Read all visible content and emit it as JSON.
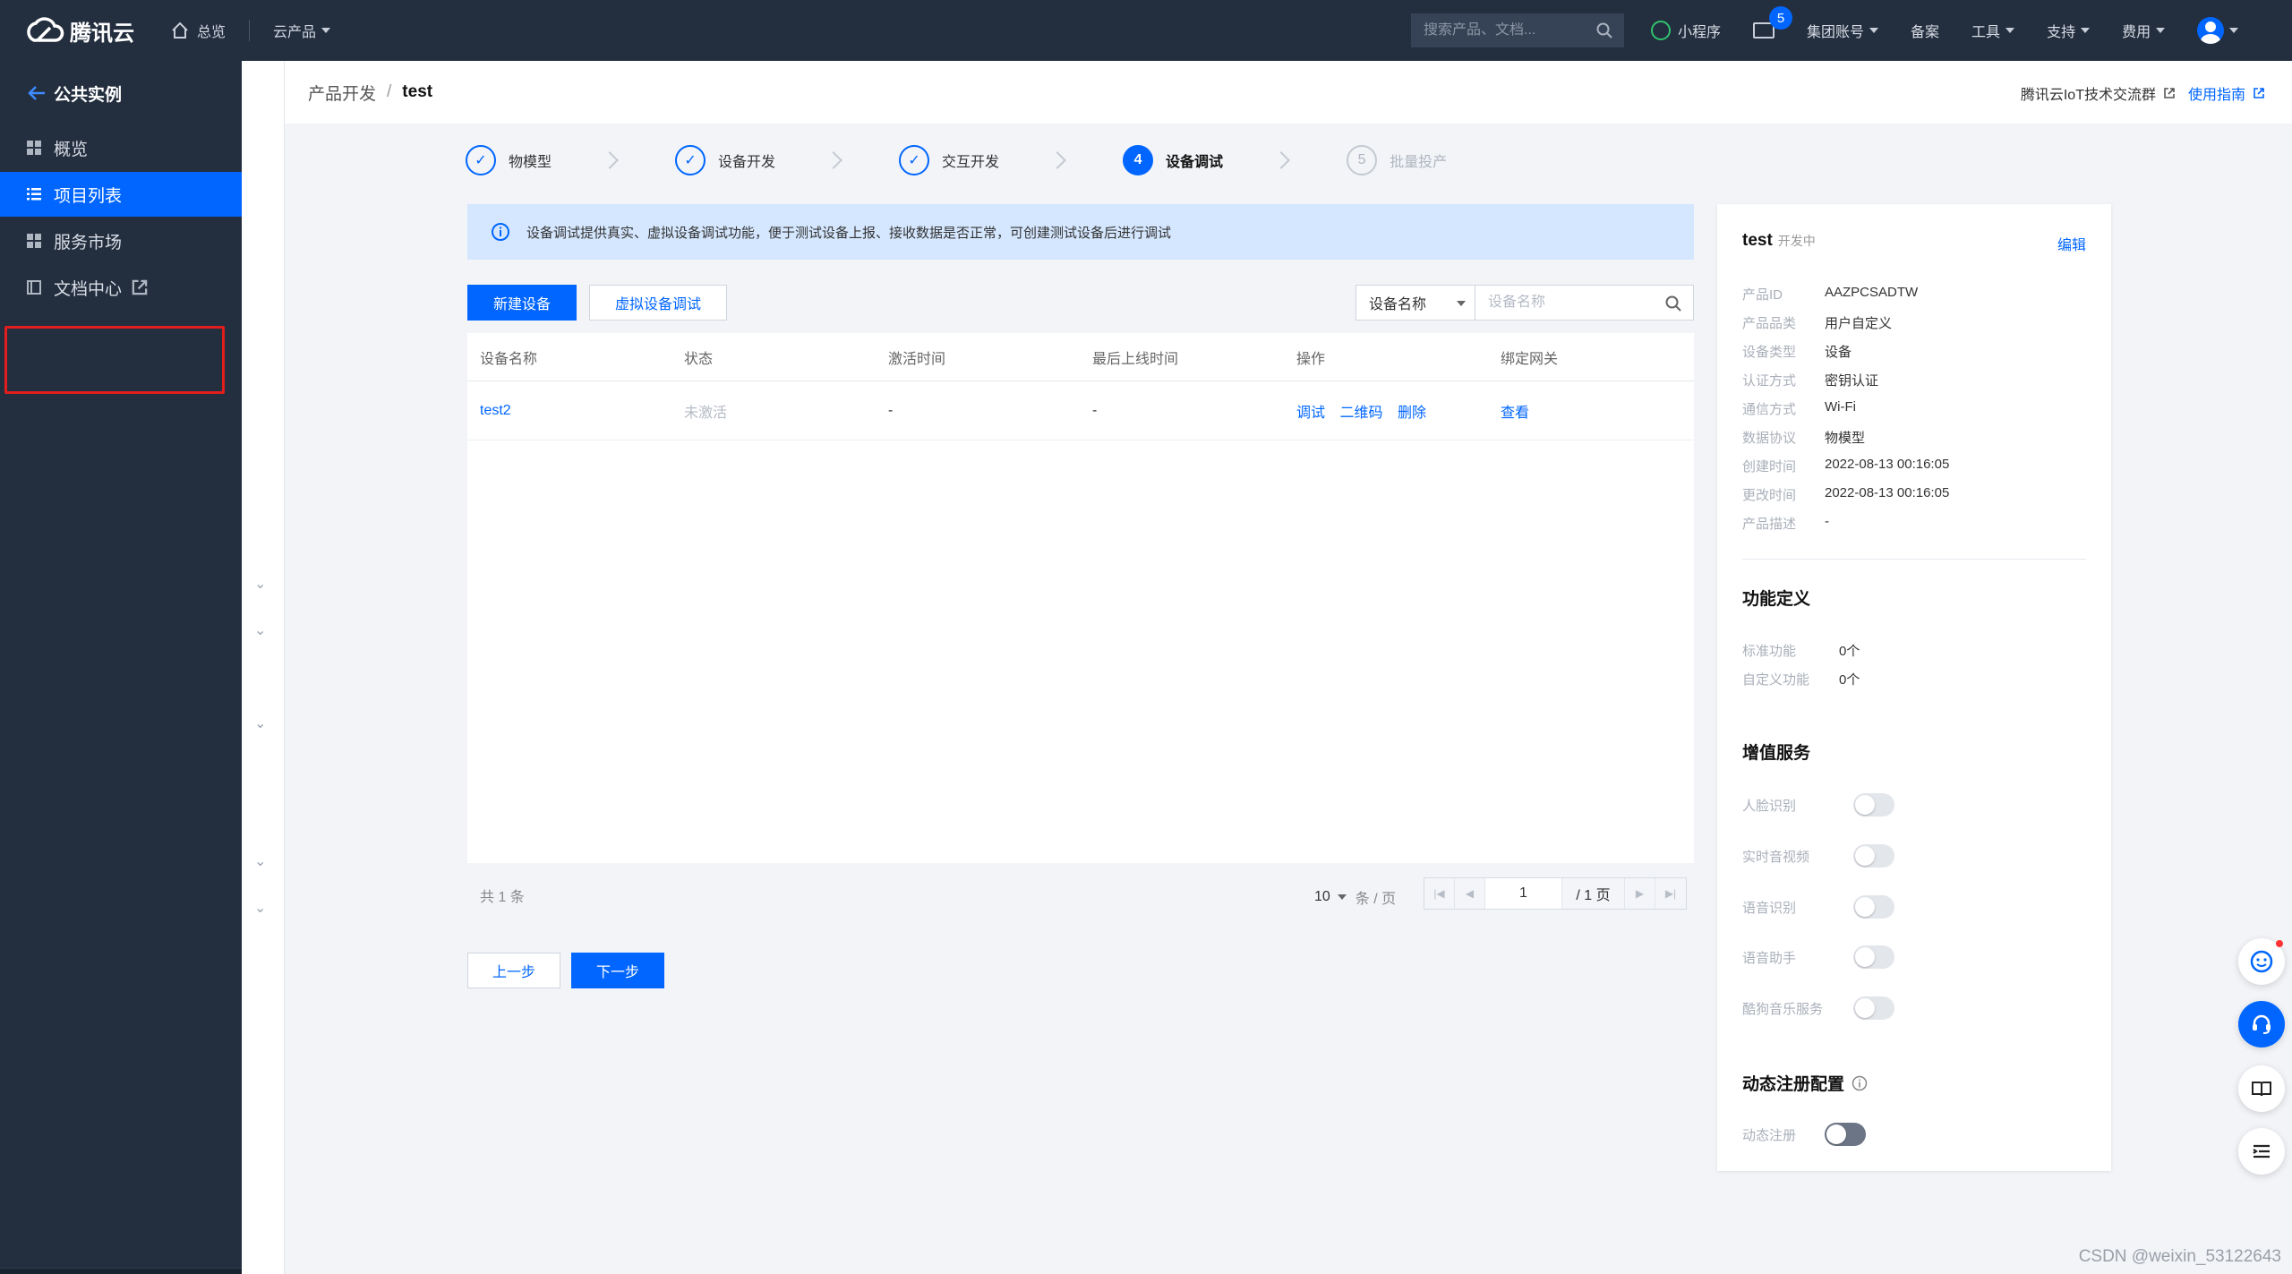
{
  "topbar": {
    "brand": "腾讯云",
    "home": "总览",
    "products": "云产品",
    "search_placeholder": "搜索产品、文档...",
    "mini_program": "小程序",
    "mail_badge": "5",
    "group_account": "集团账号",
    "filing": "备案",
    "tools": "工具",
    "support": "支持",
    "billing": "费用"
  },
  "sidebar": {
    "title": "公共实例",
    "items": [
      {
        "label": "概览",
        "icon": "grid-icon"
      },
      {
        "label": "项目列表",
        "icon": "list-icon"
      },
      {
        "label": "服务市场",
        "icon": "grid-icon"
      },
      {
        "label": "文档中心",
        "icon": "doc-icon"
      }
    ]
  },
  "header": {
    "crumb_parent": "产品开发",
    "crumb_sep": "/",
    "crumb_current": "test",
    "community": "腾讯云IoT技术交流群",
    "guide": "使用指南"
  },
  "steps": [
    {
      "label": "物模型",
      "status": "done"
    },
    {
      "label": "设备开发",
      "status": "done"
    },
    {
      "label": "交互开发",
      "status": "done"
    },
    {
      "label": "设备调试",
      "status": "current",
      "num": "4"
    },
    {
      "label": "批量投产",
      "status": "todo",
      "num": "5"
    }
  ],
  "info_text": "设备调试提供真实、虚拟设备调试功能，便于测试设备上报、接收数据是否正常，可创建测试设备后进行调试",
  "toolbar": {
    "new_device": "新建设备",
    "virtual_debug": "虚拟设备调试",
    "filter_select": "设备名称",
    "search_placeholder": "设备名称"
  },
  "table": {
    "headers": [
      "设备名称",
      "状态",
      "激活时间",
      "最后上线时间",
      "操作",
      "绑定网关"
    ],
    "rows": [
      {
        "name": "test2",
        "status": "未激活",
        "activated": "-",
        "last_online": "-",
        "ops": [
          "调试",
          "二维码",
          "删除"
        ],
        "gateway": "查看"
      }
    ]
  },
  "pager": {
    "total": "共 1 条",
    "page_size": "10",
    "page_size_unit": "条 / 页",
    "page": "1",
    "page_total": "/ 1 页"
  },
  "nav_buttons": {
    "prev": "上一步",
    "next": "下一步"
  },
  "panel": {
    "name": "test",
    "state": "开发中",
    "edit": "编辑",
    "props": [
      {
        "k": "产品ID",
        "v": "AAZPCSADTW"
      },
      {
        "k": "产品品类",
        "v": "用户自定义"
      },
      {
        "k": "设备类型",
        "v": "设备"
      },
      {
        "k": "认证方式",
        "v": "密钥认证"
      },
      {
        "k": "通信方式",
        "v": "Wi-Fi"
      },
      {
        "k": "数据协议",
        "v": "物模型"
      },
      {
        "k": "创建时间",
        "v": "2022-08-13 00:16:05"
      },
      {
        "k": "更改时间",
        "v": "2022-08-13 00:16:05"
      },
      {
        "k": "产品描述",
        "v": "-"
      }
    ],
    "func_title": "功能定义",
    "funcs": [
      {
        "k": "标准功能",
        "v": "0个"
      },
      {
        "k": "自定义功能",
        "v": "0个"
      }
    ],
    "vas_title": "增值服务",
    "services": [
      "人脸识别",
      "实时音视频",
      "语音识别",
      "语音助手",
      "酷狗音乐服务"
    ],
    "dyn_title": "动态注册配置",
    "dyn_label": "动态注册"
  },
  "watermark": "CSDN @weixin_53122643",
  "colors": {
    "primary": "#0066ff",
    "topbar": "#232e3e",
    "highlight_box": "#e21d1d"
  }
}
